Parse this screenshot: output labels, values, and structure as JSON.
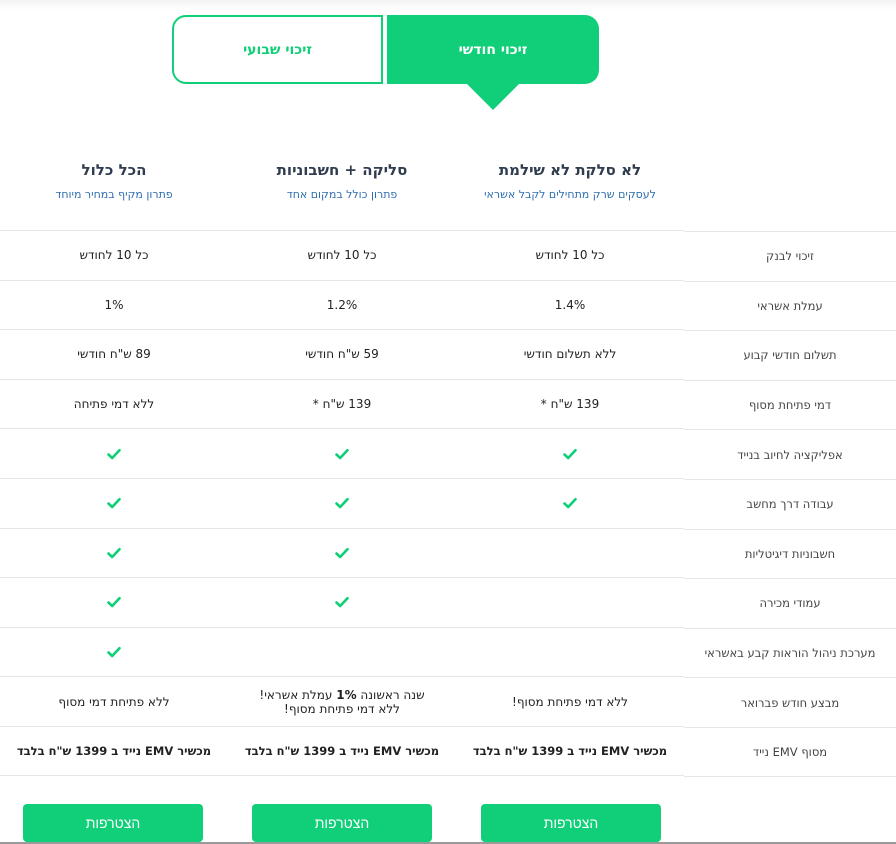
{
  "toggle": {
    "weekly": "זיכוי שבועי",
    "monthly": "זיכוי חודשי"
  },
  "plans": [
    {
      "title": "לא סלקת לא שילמת",
      "subtitle": "לעסקים שרק מתחילים לקבל אשראי",
      "button": "הצטרפות"
    },
    {
      "title": "סליקה + חשבוניות",
      "subtitle": "פתרון כולל במקום אחד",
      "button": "הצטרפות"
    },
    {
      "title": "הכל כלול",
      "subtitle": "פתרון מקיף במחיר מיוחד",
      "button": "הצטרפות"
    }
  ],
  "features": [
    {
      "label": "זיכוי לבנק",
      "values": [
        "כל 10 לחודש",
        "כל 10 לחודש",
        "כל 10 לחודש"
      ]
    },
    {
      "label": "עמלת אשראי",
      "values": [
        "1.4%",
        "1.2%",
        "1%"
      ]
    },
    {
      "label": "תשלום חודשי קבוע",
      "values": [
        "ללא תשלום חודשי",
        "59 ש\"ח חודשי",
        "89 ש\"ח חודשי"
      ]
    },
    {
      "label": "דמי פתיחת מסוף",
      "values": [
        "139 ש\"ח *",
        "139 ש\"ח *",
        "ללא דמי פתיחה"
      ]
    },
    {
      "label": "אפליקציה לחיוב בנייד",
      "checks": [
        true,
        true,
        true
      ]
    },
    {
      "label": "עבודה דרך מחשב",
      "checks": [
        true,
        true,
        true
      ]
    },
    {
      "label": "חשבוניות דיגיטליות",
      "checks": [
        false,
        true,
        true
      ]
    },
    {
      "label": "עמודי מכירה",
      "checks": [
        false,
        true,
        true
      ]
    },
    {
      "label": "מערכת ניהול הוראות קבע באשראי",
      "checks": [
        false,
        false,
        true
      ]
    },
    {
      "label": "מבצע חודש פברואר",
      "values": [
        "ללא דמי פתיחת מסוף!",
        "שנה ראשונה 1% עמלת אשראי! ללא דמי פתיחת מסוף!",
        "ללא פתיחת דמי מסוף"
      ]
    },
    {
      "label": "מסוף EMV נייד",
      "values": [
        "מכשיר EMV נייד ב 1399 ש\"ח בלבד",
        "מכשיר EMV נייד ב 1399 ש\"ח בלבד",
        "מכשיר EMV נייד ב 1399  ש\"ח בלבד"
      ]
    }
  ],
  "promo": {
    "line1_prefix": "שנה ראשונה ",
    "line1_bold": "1%",
    "line1_suffix": " עמלת אשראי!",
    "line2": "ללא דמי פתיחת מסוף!"
  },
  "colors": {
    "accent": "#10cf78",
    "title": "#2f3d4f",
    "subtitle": "#2f6fb1"
  }
}
